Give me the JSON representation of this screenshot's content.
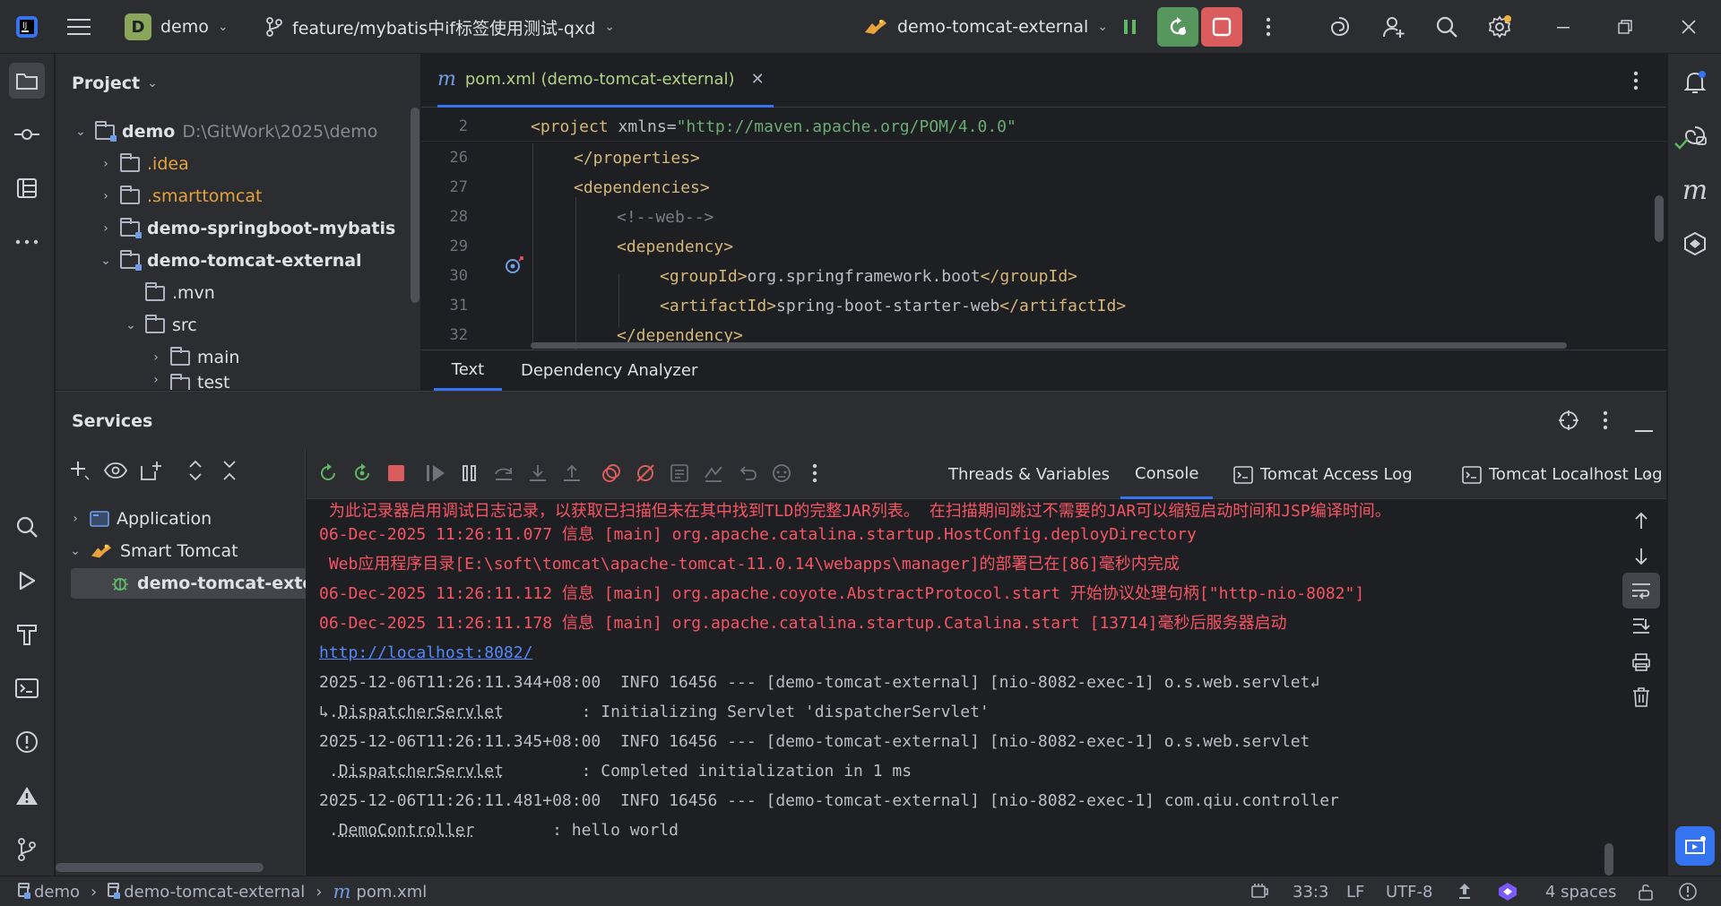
{
  "titlebar": {
    "project_initial": "D",
    "project_name": "demo",
    "branch": "feature/mybatis中if标签使用测试-qxd",
    "run_config": "demo-tomcat-external"
  },
  "project_panel": {
    "title": "Project",
    "rows": [
      {
        "label": "demo",
        "path": "D:\\GitWork\\2025\\demo"
      },
      {
        "label": ".idea"
      },
      {
        "label": ".smarttomcat"
      },
      {
        "label": "demo-springboot-mybatis"
      },
      {
        "label": "demo-tomcat-external"
      },
      {
        "label": ".mvn"
      },
      {
        "label": "src"
      },
      {
        "label": "main"
      },
      {
        "label": "test"
      }
    ]
  },
  "editor": {
    "tab_label": "pom.xml (demo-tomcat-external)",
    "lines": [
      {
        "num": "2",
        "open": "<project",
        "attr": " xmlns=",
        "str": "\"http://maven.apache.org/POM/4.0.0\""
      },
      {
        "num": "26",
        "text": "</properties>"
      },
      {
        "num": "27",
        "text": "<dependencies>"
      },
      {
        "num": "28",
        "text": "<!--web-->"
      },
      {
        "num": "29",
        "text": "<dependency>"
      },
      {
        "num": "30",
        "open": "<groupId>",
        "body": "org.springframework.boot",
        "close": "</groupId>"
      },
      {
        "num": "31",
        "open": "<artifactId>",
        "body": "spring-boot-starter-web",
        "close": "</artifactId>"
      },
      {
        "num": "32",
        "text": "</dependency>"
      }
    ],
    "bottom_tabs": [
      "Text",
      "Dependency Analyzer"
    ]
  },
  "services": {
    "title": "Services",
    "tree": [
      {
        "label": "Application"
      },
      {
        "label": "Smart Tomcat"
      },
      {
        "label": "demo-tomcat-external"
      }
    ],
    "tabs": [
      "Threads & Variables",
      "Console",
      "Tomcat Access Log",
      "Tomcat Localhost Log"
    ],
    "console": [
      {
        "cls": "red",
        "text": " 为此记录器启用调试日志记录，以获取已扫描但未在其中找到TLD的完整JAR列表。 在扫描期间跳过不需要的JAR可以缩短启动时间和JSP编译时间。"
      },
      {
        "cls": "red",
        "text": "06-Dec-2025 11:26:11.077 信息 [main] org.apache.catalina.startup.HostConfig.deployDirectory"
      },
      {
        "cls": "red",
        "text": " Web应用程序目录[E:\\soft\\tomcat\\apache-tomcat-11.0.14\\webapps\\manager]的部署已在[86]毫秒内完成"
      },
      {
        "cls": "red",
        "text": "06-Dec-2025 11:26:11.112 信息 [main] org.apache.coyote.AbstractProtocol.start 开始协议处理句柄[\"http-nio-8082\"]"
      },
      {
        "cls": "red",
        "text": "06-Dec-2025 11:26:11.178 信息 [main] org.apache.catalina.startup.Catalina.start [13714]毫秒后服务器启动"
      },
      {
        "cls": "link",
        "text": "http://localhost:8082/"
      },
      {
        "cls": "plain",
        "text": "2025-12-06T11:26:11.344+08:00  INFO 16456 --- [demo-tomcat-external] [nio-8082-exec-1] o.s.web.servlet↲"
      },
      {
        "cls": "plain",
        "pre": "↳.",
        "ul": "DispatcherServlet",
        "post": "        : Initializing Servlet 'dispatcherServlet'"
      },
      {
        "cls": "plain",
        "text": "2025-12-06T11:26:11.345+08:00  INFO 16456 --- [demo-tomcat-external] [nio-8082-exec-1] o.s.web.servlet"
      },
      {
        "cls": "plain",
        "pre": " .",
        "ul": "DispatcherServlet",
        "post": "        : Completed initialization in 1 ms"
      },
      {
        "cls": "plain",
        "text": "2025-12-06T11:26:11.481+08:00  INFO 16456 --- [demo-tomcat-external] [nio-8082-exec-1] com.qiu.controller"
      },
      {
        "cls": "plain",
        "pre": " .",
        "ul": "DemoController",
        "post": "        : hello world"
      }
    ]
  },
  "statusbar": {
    "crumbs": [
      "demo",
      "demo-tomcat-external",
      "pom.xml"
    ],
    "position": "33:3",
    "line_sep": "LF",
    "encoding": "UTF-8",
    "indent": "4 spaces"
  }
}
